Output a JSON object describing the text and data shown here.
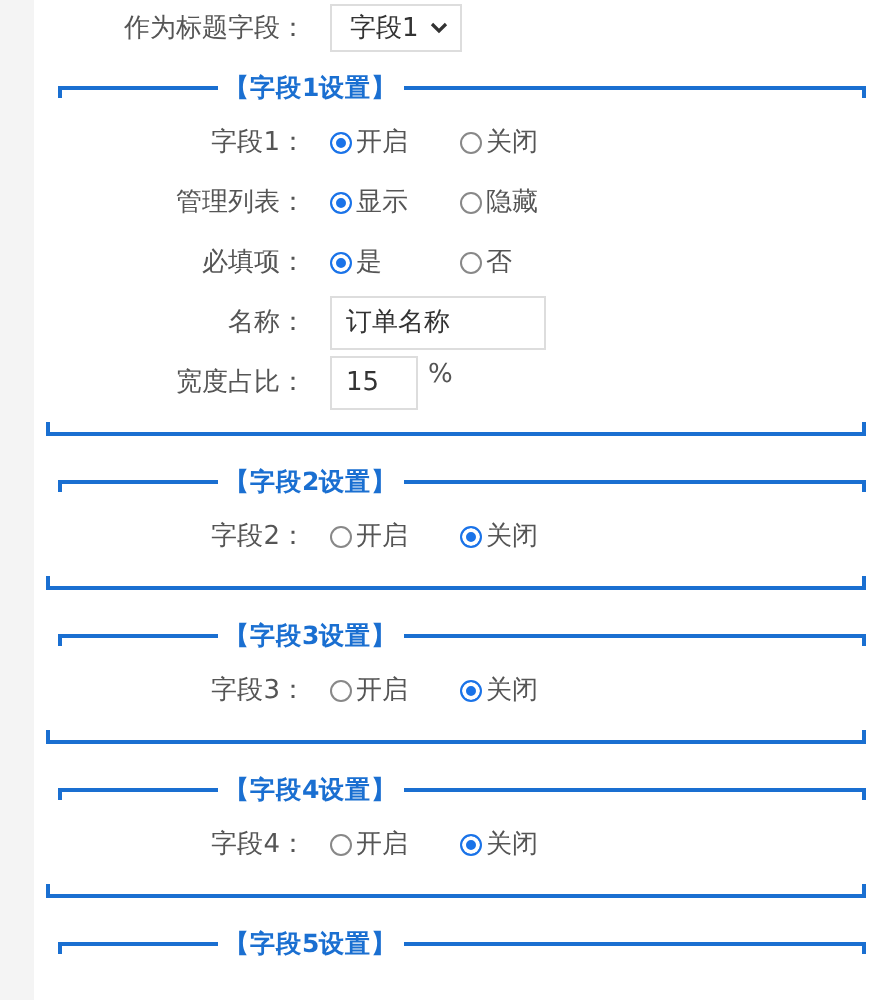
{
  "title_field": {
    "label": "作为标题字段：",
    "value": "字段1"
  },
  "sections": [
    {
      "title": "【字段1设置】",
      "rows": [
        {
          "kind": "radio",
          "label": "字段1：",
          "options": [
            {
              "label": "开启",
              "selected": true
            },
            {
              "label": "关闭",
              "selected": false
            }
          ]
        },
        {
          "kind": "radio",
          "label": "管理列表：",
          "options": [
            {
              "label": "显示",
              "selected": true
            },
            {
              "label": "隐藏",
              "selected": false
            }
          ]
        },
        {
          "kind": "radio",
          "label": "必填项：",
          "options": [
            {
              "label": "是",
              "selected": true
            },
            {
              "label": "否",
              "selected": false
            }
          ]
        },
        {
          "kind": "text",
          "label": "名称：",
          "value": "订单名称"
        },
        {
          "kind": "percent",
          "label": "宽度占比：",
          "value": "15",
          "unit": "%"
        }
      ]
    },
    {
      "title": "【字段2设置】",
      "rows": [
        {
          "kind": "radio",
          "label": "字段2：",
          "options": [
            {
              "label": "开启",
              "selected": false
            },
            {
              "label": "关闭",
              "selected": true
            }
          ]
        }
      ]
    },
    {
      "title": "【字段3设置】",
      "rows": [
        {
          "kind": "radio",
          "label": "字段3：",
          "options": [
            {
              "label": "开启",
              "selected": false
            },
            {
              "label": "关闭",
              "selected": true
            }
          ]
        }
      ]
    },
    {
      "title": "【字段4设置】",
      "rows": [
        {
          "kind": "radio",
          "label": "字段4：",
          "options": [
            {
              "label": "开启",
              "selected": false
            },
            {
              "label": "关闭",
              "selected": true
            }
          ]
        }
      ]
    },
    {
      "title": "【字段5设置】"
    }
  ]
}
